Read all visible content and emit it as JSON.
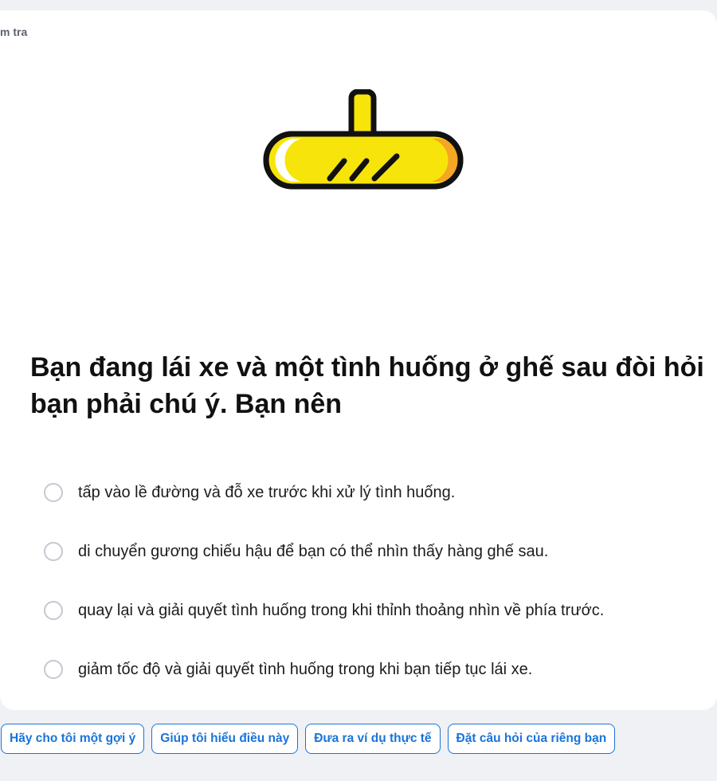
{
  "header": {
    "breadcrumb": "m tra"
  },
  "illustration": {
    "icon": "rearview-mirror-icon",
    "colors": {
      "fill": "#f7e40a",
      "shade": "#f5a623",
      "outline": "#111111"
    }
  },
  "question": {
    "text": "Bạn đang lái xe và một tình huống ở ghế sau đòi hỏi bạn phải chú ý. Bạn nên"
  },
  "options": [
    {
      "label": "tấp vào lề đường và đỗ xe trước khi xử lý tình huống."
    },
    {
      "label": "di chuyển gương chiếu hậu để bạn có thể nhìn thấy hàng ghế sau."
    },
    {
      "label": "quay lại và giải quyết tình huống trong khi thỉnh thoảng nhìn về phía trước."
    },
    {
      "label": "giảm tốc độ và giải quyết tình huống trong khi bạn tiếp tục lái xe."
    }
  ],
  "suggestions": [
    {
      "label": "Hãy cho tôi một gợi ý"
    },
    {
      "label": "Giúp tôi hiểu điều này"
    },
    {
      "label": "Đưa ra ví dụ thực tế"
    },
    {
      "label": "Đặt câu hỏi của riêng bạn"
    }
  ],
  "theme": {
    "accent": "#1a73d9",
    "background": "#f0f1f5",
    "card": "#ffffff"
  }
}
